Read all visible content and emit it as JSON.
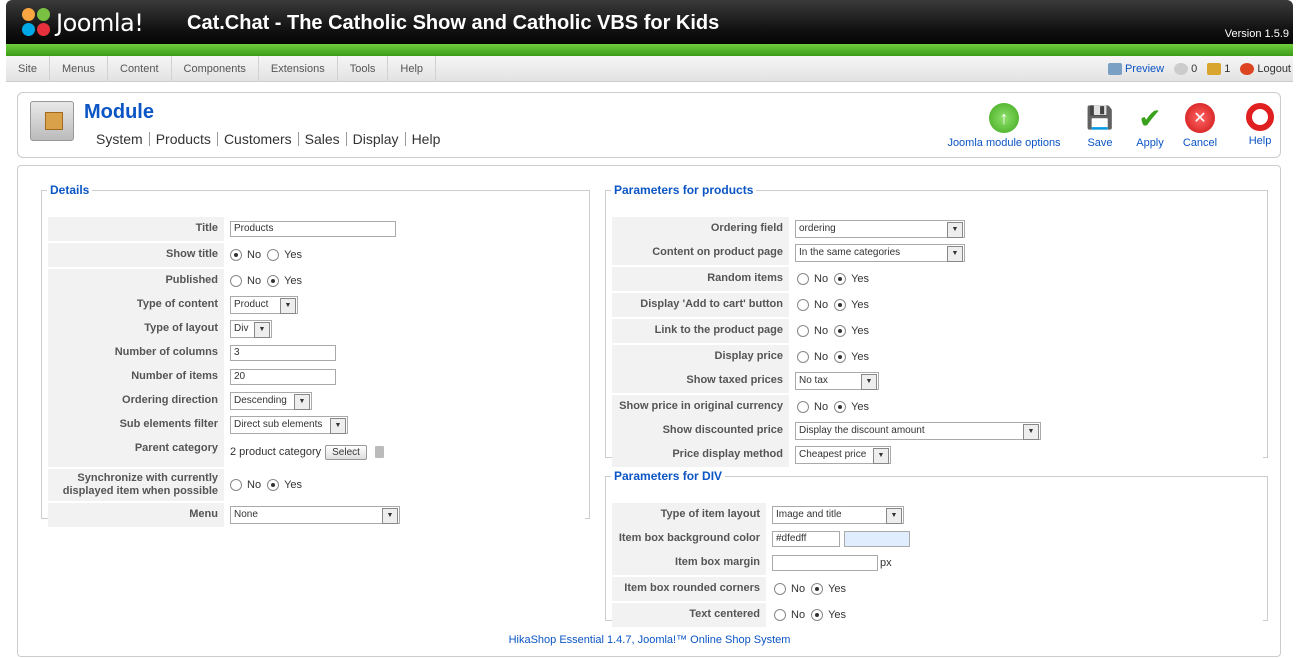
{
  "header": {
    "logo": "Joomla!",
    "site_title": "Cat.Chat - The Catholic Show and Catholic VBS for Kids",
    "version": "Version 1.5.9"
  },
  "menu": [
    "Site",
    "Menus",
    "Content",
    "Components",
    "Extensions",
    "Tools",
    "Help"
  ],
  "status": {
    "preview": "Preview",
    "messages": "0",
    "users": "1",
    "logout": "Logout"
  },
  "page": {
    "title": "Module",
    "subnav": [
      "System",
      "Products",
      "Customers",
      "Sales",
      "Display",
      "Help"
    ]
  },
  "toolbar": {
    "options": "Joomla module options",
    "save": "Save",
    "apply": "Apply",
    "cancel": "Cancel",
    "help": "Help"
  },
  "details": {
    "legend": "Details",
    "title_label": "Title",
    "title_value": "Products",
    "show_title_label": "Show title",
    "published_label": "Published",
    "type_content_label": "Type of content",
    "type_content_value": "Product",
    "type_layout_label": "Type of layout",
    "type_layout_value": "Div",
    "columns_label": "Number of columns",
    "columns_value": "3",
    "items_label": "Number of items",
    "items_value": "20",
    "ordering_dir_label": "Ordering direction",
    "ordering_dir_value": "Descending",
    "sub_filter_label": "Sub elements filter",
    "sub_filter_value": "Direct sub elements",
    "parent_label": "Parent category",
    "parent_value": "2 product category",
    "select_btn": "Select",
    "sync_label_1": "Synchronize with currently",
    "sync_label_2": "displayed item when possible",
    "menu_label": "Menu",
    "menu_value": "None",
    "no": "No",
    "yes": "Yes"
  },
  "products": {
    "legend": "Parameters for products",
    "ordering_label": "Ordering field",
    "ordering_value": "ordering",
    "content_label": "Content on product page",
    "content_value": "In the same categories",
    "random_label": "Random items",
    "cart_label": "Display 'Add to cart' button",
    "link_label": "Link to the product page",
    "price_label": "Display price",
    "taxed_label": "Show taxed prices",
    "taxed_value": "No tax",
    "orig_label": "Show price in original currency",
    "discount_label": "Show discounted price",
    "discount_value": "Display the discount amount",
    "method_label": "Price display method",
    "method_value": "Cheapest price"
  },
  "div": {
    "legend": "Parameters for DIV",
    "layout_label": "Type of item layout",
    "layout_value": "Image and title",
    "bg_label": "Item box background color",
    "bg_value": "#dfedff",
    "margin_label": "Item box margin",
    "margin_unit": "px",
    "rounded_label": "Item box rounded corners",
    "centered_label": "Text centered"
  },
  "footer": "HikaShop Essential 1.4.7, Joomla!™ Online Shop System",
  "colors": {
    "link": "#0b55c4",
    "swatch": "#dfedff",
    "header_green": "#4fb526"
  }
}
